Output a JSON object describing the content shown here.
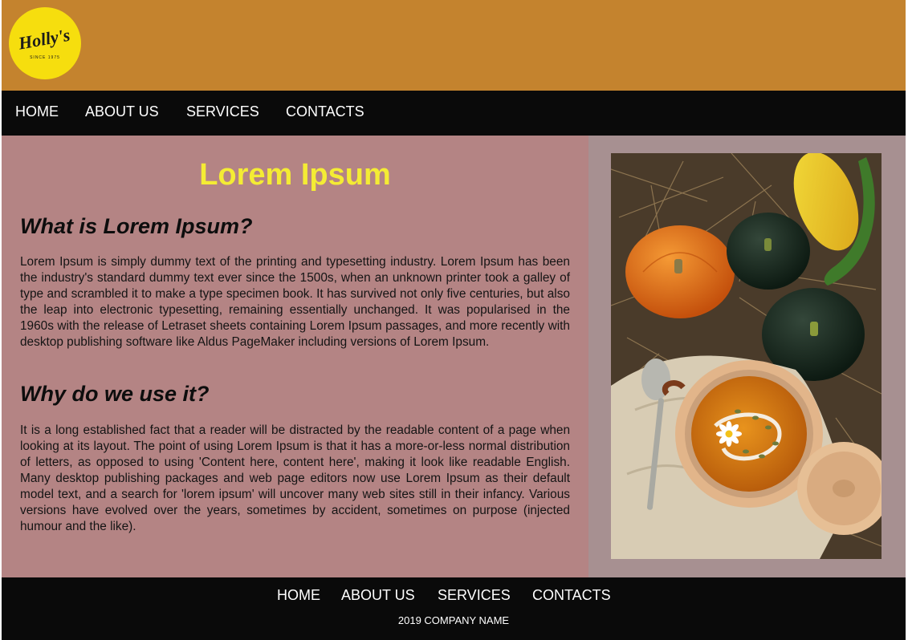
{
  "header": {
    "logo_text": "Holly's",
    "logo_subtext": "SINCE 1975",
    "colors": {
      "background": "#c4832e",
      "logo": "#f6de0e"
    }
  },
  "nav": {
    "items": [
      {
        "label": "HOME"
      },
      {
        "label": "ABOUT US"
      },
      {
        "label": "SERVICES"
      },
      {
        "label": "CONTACTS"
      }
    ]
  },
  "main": {
    "title": "Lorem Ipsum",
    "sections": [
      {
        "heading": "What is Lorem Ipsum?",
        "text": "Lorem Ipsum is simply dummy text of the printing and typesetting industry. Lorem Ipsum has been the industry's standard dummy text ever since the 1500s, when an unknown printer took a galley of type and scrambled it to make a type specimen book. It has survived not only five centuries, but also the leap into electronic typesetting, remaining essentially unchanged. It was popularised in the 1960s with the release of Letraset sheets containing Lorem Ipsum passages, and more recently with desktop publishing software like Aldus PageMaker including versions of Lorem Ipsum."
      },
      {
        "heading": "Why do we use it?",
        "text": "It is a long established fact that a reader will be distracted by the readable content of a page when looking at its layout. The point of using Lorem Ipsum is that it has a more-or-less normal distribution of letters, as opposed to using 'Content here, content here', making it look like readable English. Many desktop publishing packages and web page editors now use Lorem Ipsum as their default model text, and a search for 'lorem ipsum' will uncover many web sites still in their infancy. Various versions have evolved over the years, sometimes by accident, sometimes on purpose (injected humour and the like)."
      }
    ],
    "colors": {
      "left_panel": "#b48484",
      "right_panel": "#a79091",
      "title": "#f4ec34"
    }
  },
  "footer": {
    "items": [
      {
        "label": "HOME"
      },
      {
        "label": "ABOUT US"
      },
      {
        "label": "SERVICES"
      },
      {
        "label": "CONTACTS"
      }
    ],
    "copyright": "2019 COMPANY NAME"
  }
}
